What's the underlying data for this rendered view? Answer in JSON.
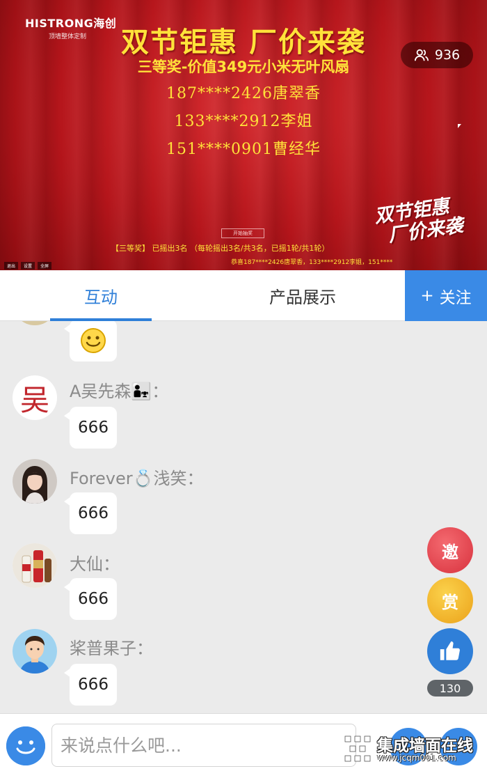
{
  "video": {
    "logo": "HISTRONG海创",
    "logo_sub": "顶墙整体定制",
    "headline": "双节钜惠  厂价来袭",
    "prize_title": "三等奖-价值349元小米无叶风扇",
    "winners": [
      "187****2426唐翠香",
      "133****2912李姐",
      "151****0901曹经华"
    ],
    "viewer_count": "936",
    "small_button": "开始抽奖",
    "draw_status": "【三等奖】 已摇出3名 （每轮摇出3名/共3名，已摇1轮/共1轮）",
    "congrats": "恭喜187****2426唐翠香，133****2912李姐，151****",
    "corner_logo": [
      "双节钜惠",
      "厂价来袭"
    ],
    "controls": [
      "退出",
      "设置",
      "全屏"
    ],
    "theme_red": "#b5151b",
    "theme_yellow": "#ffe23a"
  },
  "tabs": {
    "interaction": "互动",
    "products": "产品展示",
    "follow": "关注",
    "follow_icon": "+",
    "accent": "#2f7fd8"
  },
  "chat": {
    "messages": [
      {
        "username": "",
        "text": "☺",
        "avatar": "partial-avatar"
      },
      {
        "username": "A吴先森👨‍👧：",
        "text": "666",
        "avatar": "wu-calligraphy-avatar"
      },
      {
        "username": "Forever💍浅笑：",
        "text": "666",
        "avatar": "woman-photo-avatar"
      },
      {
        "username": "大仙：",
        "text": "666",
        "avatar": "bottles-photo-avatar"
      },
      {
        "username": "桨普果子：",
        "text": "666",
        "avatar": "cartoon-man-avatar"
      }
    ],
    "wu_char": "吴"
  },
  "side_buttons": {
    "invite": "邀",
    "reward": "赏",
    "like_count": "130"
  },
  "bottom": {
    "placeholder": "来说点什么吧...",
    "watermark_title": "集成墙面在线",
    "watermark_url": "www.jcqm001.com"
  }
}
